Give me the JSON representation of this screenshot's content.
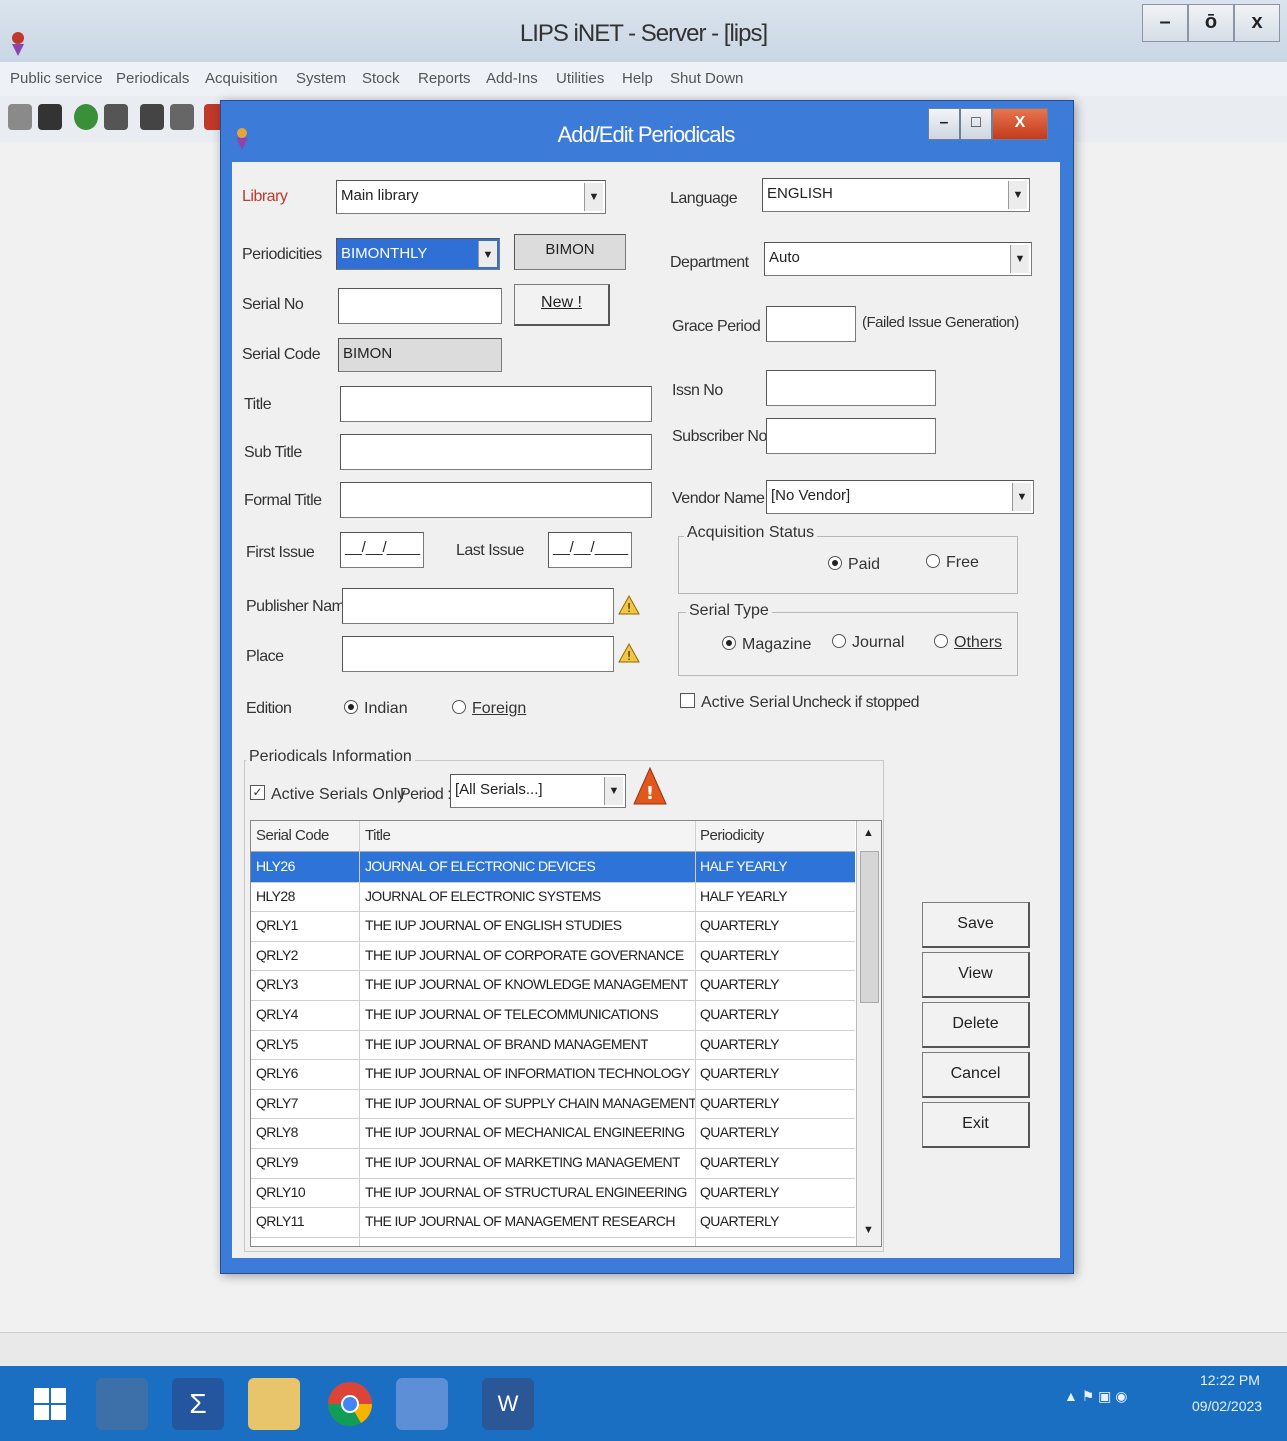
{
  "main_window": {
    "title": "LIPS iNET - Server - [lips]",
    "controls": {
      "minimize": "–",
      "restore": "ō",
      "close": "x"
    },
    "menu": [
      "Public service",
      "Periodicals",
      "Acquisition",
      "System",
      "Stock",
      "Reports",
      "Add-Ins",
      "Utilities",
      "Help",
      "Shut Down"
    ]
  },
  "dialog": {
    "title": "Add/Edit Periodicals",
    "controls": {
      "minimize": "–",
      "restore": "□",
      "close": "X"
    },
    "library": {
      "label": "Library",
      "value": "Main library"
    },
    "periodicities": {
      "label": "Periodicities",
      "value": "BIMONTHLY",
      "code": "BIMON"
    },
    "serial_no": {
      "label": "Serial No",
      "value": "",
      "new_button": "New !"
    },
    "serial_code": {
      "label": "Serial Code",
      "value": "BIMON"
    },
    "title_field": {
      "label": "Title",
      "value": ""
    },
    "sub_title": {
      "label": "Sub Title",
      "value": ""
    },
    "formal_title": {
      "label": "Formal Title",
      "value": ""
    },
    "first_issue": {
      "label": "First Issue",
      "value": "__/__/____"
    },
    "last_issue": {
      "label": "Last Issue",
      "value": "__/__/____"
    },
    "publisher_name": {
      "label": "Publisher Name",
      "value": ""
    },
    "place": {
      "label": "Place",
      "value": ""
    },
    "edition": {
      "label": "Edition",
      "options": [
        "Indian",
        "Foreign"
      ],
      "selected": "Indian"
    },
    "language": {
      "label": "Language",
      "value": "ENGLISH"
    },
    "department": {
      "label": "Department",
      "value": "Auto"
    },
    "grace_period": {
      "label": "Grace Period",
      "value": "",
      "note": "(Failed Issue Generation)"
    },
    "issn_no": {
      "label": "Issn No",
      "value": ""
    },
    "subscriber_no": {
      "label": "Subscriber No",
      "value": ""
    },
    "vendor_name": {
      "label": "Vendor Name",
      "value": "[No Vendor]"
    },
    "acquisition_status": {
      "label": "Acquisition Status",
      "options": [
        "Paid",
        "Free"
      ],
      "selected": "Paid"
    },
    "serial_type": {
      "label": "Serial Type",
      "options": [
        "Magazine",
        "Journal",
        "Others"
      ],
      "selected": "Magazine"
    },
    "active_serial": {
      "label": "Active Serial",
      "hint": "Uncheck if stopped",
      "checked": false
    },
    "periodicals_info": {
      "label": "Periodicals Information",
      "active_serials_only": {
        "label": "Active Serials Only",
        "checked": true
      },
      "period": {
        "label": "Period :",
        "value": "[All Serials...]"
      }
    },
    "grid": {
      "columns": [
        "Serial Code",
        "Title",
        "Periodicity"
      ],
      "rows": [
        {
          "code": "HLY26",
          "title": "JOURNAL OF ELECTRONIC DEVICES",
          "periodicity": "HALF YEARLY",
          "selected": true
        },
        {
          "code": "HLY28",
          "title": "JOURNAL OF ELECTRONIC SYSTEMS",
          "periodicity": "HALF YEARLY"
        },
        {
          "code": "QRLY1",
          "title": "THE IUP JOURNAL OF ENGLISH STUDIES",
          "periodicity": "QUARTERLY"
        },
        {
          "code": "QRLY2",
          "title": "THE IUP JOURNAL OF CORPORATE GOVERNANCE",
          "periodicity": "QUARTERLY"
        },
        {
          "code": "QRLY3",
          "title": "THE IUP JOURNAL OF KNOWLEDGE MANAGEMENT",
          "periodicity": "QUARTERLY"
        },
        {
          "code": "QRLY4",
          "title": "THE IUP JOURNAL OF TELECOMMUNICATIONS",
          "periodicity": "QUARTERLY"
        },
        {
          "code": "QRLY5",
          "title": "THE IUP JOURNAL OF BRAND MANAGEMENT",
          "periodicity": "QUARTERLY"
        },
        {
          "code": "QRLY6",
          "title": "THE IUP JOURNAL OF INFORMATION TECHNOLOGY",
          "periodicity": "QUARTERLY"
        },
        {
          "code": "QRLY7",
          "title": "THE IUP JOURNAL OF SUPPLY CHAIN MANAGEMENT",
          "periodicity": "QUARTERLY"
        },
        {
          "code": "QRLY8",
          "title": "THE IUP JOURNAL OF MECHANICAL ENGINEERING",
          "periodicity": "QUARTERLY"
        },
        {
          "code": "QRLY9",
          "title": "THE IUP JOURNAL OF MARKETING MANAGEMENT",
          "periodicity": "QUARTERLY"
        },
        {
          "code": "QRLY10",
          "title": "THE IUP JOURNAL OF STRUCTURAL ENGINEERING",
          "periodicity": "QUARTERLY"
        },
        {
          "code": "QRLY11",
          "title": "THE IUP JOURNAL OF MANAGEMENT RESEARCH",
          "periodicity": "QUARTERLY"
        }
      ]
    },
    "buttons": {
      "save": "Save",
      "view": "View",
      "delete": "Delete",
      "cancel": "Cancel",
      "exit": "Exit"
    }
  },
  "taskbar": {
    "time": "12:22 PM",
    "date": "09/02/2023"
  },
  "colors": {
    "dialog_frame": "#3d7bd9",
    "selection": "#2e74d8",
    "taskbar": "#1a6fc2"
  }
}
